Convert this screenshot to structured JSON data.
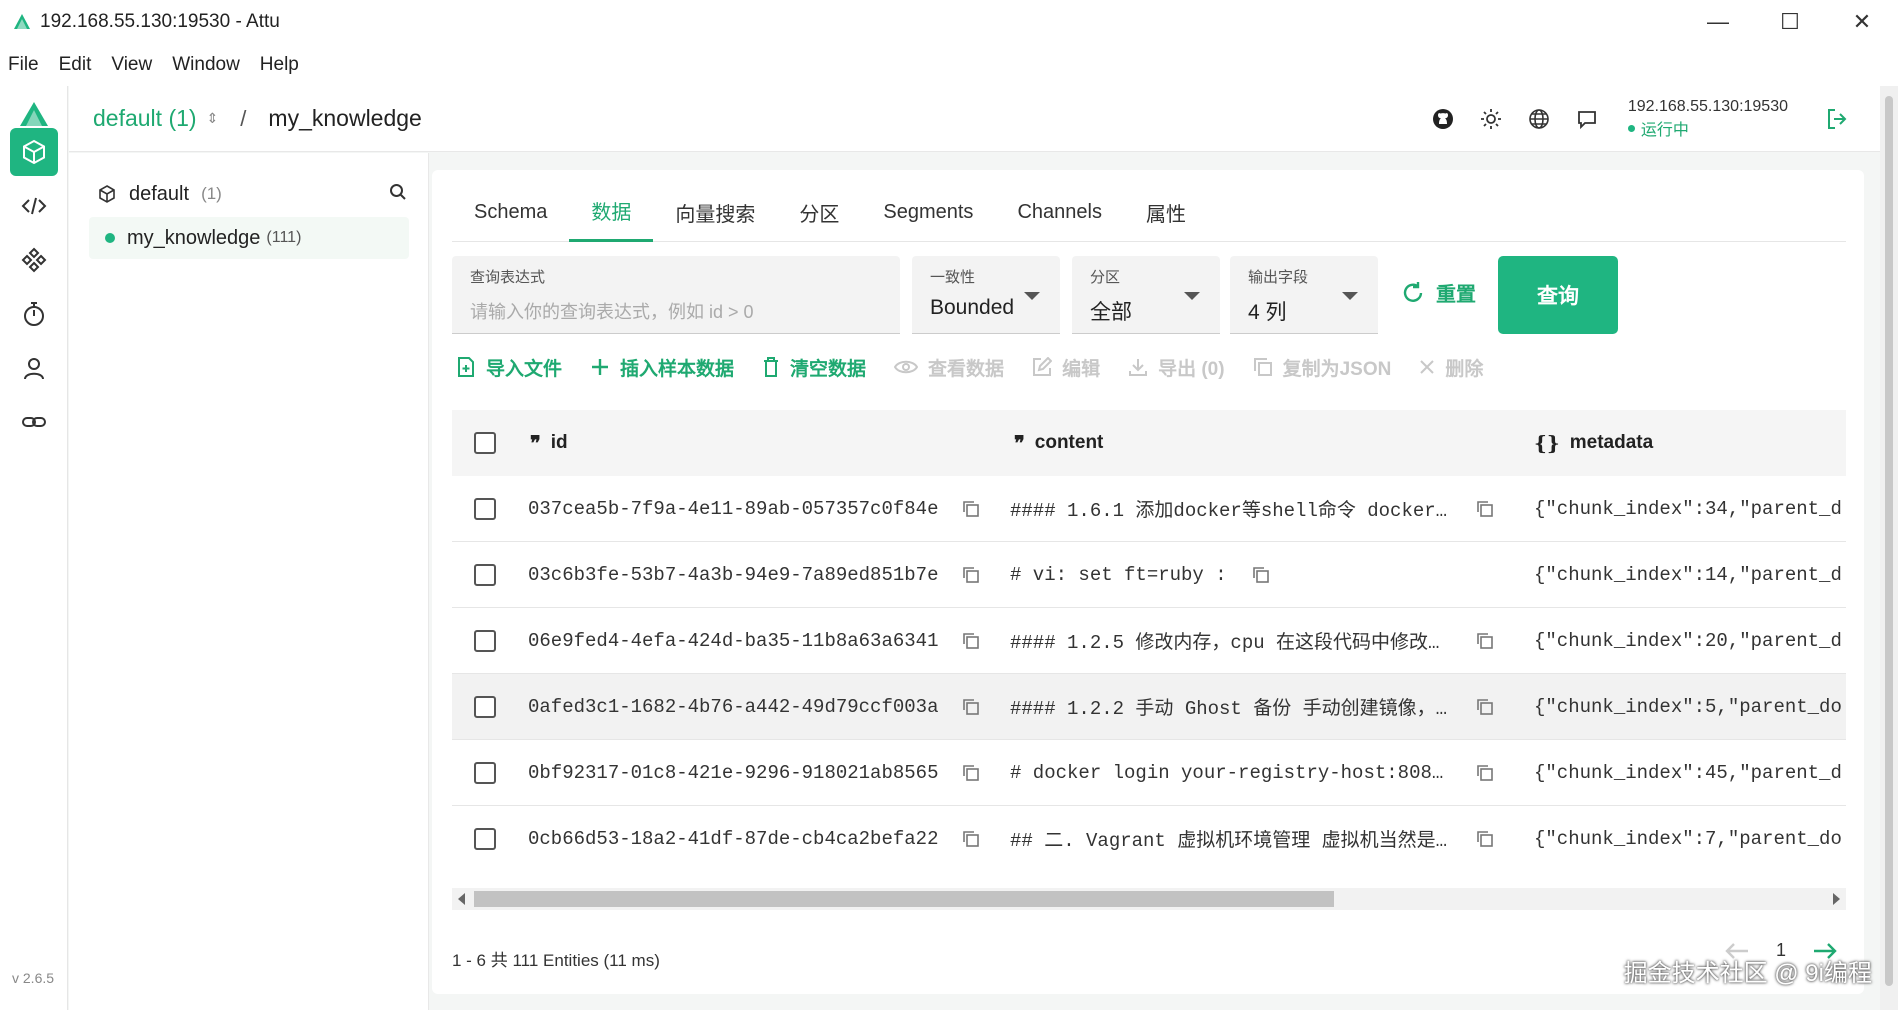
{
  "window": {
    "title": "192.168.55.130:19530 - Attu",
    "minimize": "—",
    "maximize": "☐",
    "close": "✕"
  },
  "menu": [
    "File",
    "Edit",
    "View",
    "Window",
    "Help"
  ],
  "version": "v 2.6.5",
  "breadcrumb": {
    "database": "default (1)",
    "separator": "/",
    "collection": "my_knowledge"
  },
  "connection": {
    "address": "192.168.55.130:19530",
    "status": "运行中"
  },
  "sidebar": {
    "database": {
      "name": "default",
      "count": "(1)"
    },
    "collection": {
      "name": "my_knowledge",
      "count": "(111)"
    }
  },
  "tabs": [
    "Schema",
    "数据",
    "向量搜索",
    "分区",
    "Segments",
    "Channels",
    "属性"
  ],
  "query": {
    "expr_label": "查询表达式",
    "expr_placeholder": "请输入你的查询表达式，例如 id > 0",
    "consistency_label": "一致性",
    "consistency_value": "Bounded",
    "partition_label": "分区",
    "partition_value": "全部",
    "output_label": "输出字段",
    "output_value": "4 列",
    "reset": "重置",
    "submit": "查询"
  },
  "toolbar": {
    "import": "导入文件",
    "insert_sample": "插入样本数据",
    "empty": "清空数据",
    "view": "查看数据",
    "edit": "编辑",
    "export": "导出 (0)",
    "copy_json": "复制为JSON",
    "delete": "删除"
  },
  "table": {
    "columns": [
      "id",
      "content",
      "metadata"
    ],
    "rows": [
      {
        "id": "037cea5b-7f9a-4e11-89ab-057357c0f84e",
        "content": "#### 1.6.1 添加docker等shell命令 docker…",
        "metadata": "{\"chunk_index\":34,\"parent_d"
      },
      {
        "id": "03c6b3fe-53b7-4a3b-94e9-7a89ed851b7e",
        "content": "# vi: set ft=ruby :",
        "metadata": "{\"chunk_index\":14,\"parent_d"
      },
      {
        "id": "06e9fed4-4efa-424d-ba35-11b8a63a6341",
        "content": "#### 1.2.5 修改内存，cpu 在这段代码中修改…",
        "metadata": "{\"chunk_index\":20,\"parent_d"
      },
      {
        "id": "0afed3c1-1682-4b76-a442-49d79ccf003a",
        "content": "#### 1.2.2 手动 Ghost 备份 手动创建镜像，…",
        "metadata": "{\"chunk_index\":5,\"parent_do"
      },
      {
        "id": "0bf92317-01c8-421e-9296-918021ab8565",
        "content": "# docker login your-registry-host:808…",
        "metadata": "{\"chunk_index\":45,\"parent_d"
      },
      {
        "id": "0cb66d53-18a2-41df-87de-cb4ca2befa22",
        "content": "## 二. Vagrant 虚拟机环境管理 虚拟机当然是…",
        "metadata": "{\"chunk_index\":7,\"parent_do"
      }
    ]
  },
  "footer": {
    "summary": "1 - 6 共 111 Entities (11 ms)",
    "page": "1"
  },
  "watermark": "掘金技术社区 @ 9i编程",
  "colors": {
    "accent": "#1fb581",
    "accent_text": "#1fa971"
  }
}
